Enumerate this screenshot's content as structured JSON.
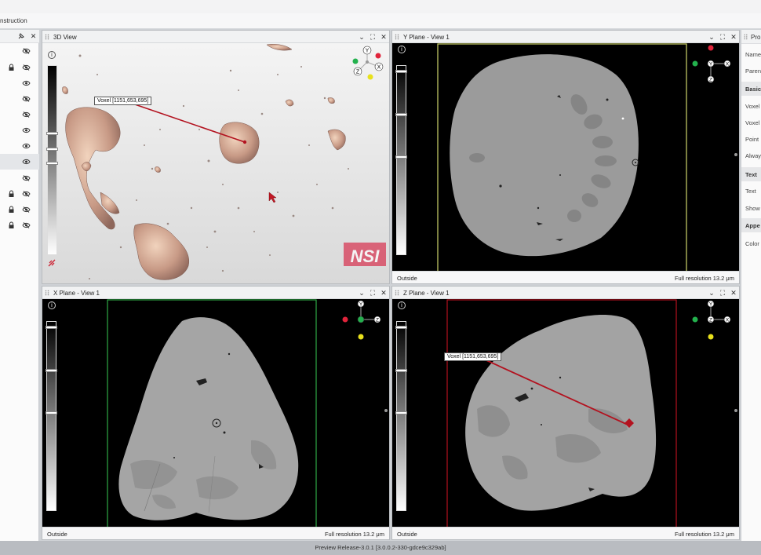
{
  "app": {
    "breadcrumb": "nstruction",
    "status": "Preview Release-3.0.1 [3.0.0.2-330-gdce9c329ab]"
  },
  "left_panel": {
    "rows": [
      {
        "locked": false,
        "visible": false
      },
      {
        "locked": true,
        "visible": false
      },
      {
        "locked": false,
        "visible": true
      },
      {
        "locked": false,
        "visible": false
      },
      {
        "locked": false,
        "visible": false
      },
      {
        "locked": false,
        "visible": true
      },
      {
        "locked": false,
        "visible": true
      },
      {
        "locked": false,
        "visible": true,
        "selected": true
      },
      {
        "locked": false,
        "visible": false
      },
      {
        "locked": true,
        "visible": false
      },
      {
        "locked": true,
        "visible": false
      },
      {
        "locked": true,
        "visible": false
      }
    ]
  },
  "right_panel": {
    "title": "Pro",
    "rows": [
      "Name",
      "Paren"
    ],
    "section_basic": "Basic",
    "basic_rows": [
      "Voxel",
      "Voxel",
      "Point",
      "Alway"
    ],
    "section_text": "Text",
    "text_rows": [
      "Text",
      "Show"
    ],
    "section_appearance": "Appe",
    "appearance_rows": [
      "Color"
    ]
  },
  "panes": {
    "view3d": {
      "title": "3D View",
      "voxel_label": "Voxel [1151,653,695]",
      "logo": "NSI"
    },
    "yplane": {
      "title": "Y Plane - View 1",
      "footer_left": "Outside",
      "footer_right": "Full resolution 13.2 μm"
    },
    "xplane": {
      "title": "X Plane - View 1",
      "footer_left": "Outside",
      "footer_right": "Full resolution 13.2 μm"
    },
    "zplane": {
      "title": "Z Plane - View 1",
      "voxel_label": "Voxel [1151,653,695]",
      "footer_left": "Outside",
      "footer_right": "Full resolution 13.2 μm"
    }
  },
  "axes": {
    "x": "X",
    "y": "Y",
    "z": "Z"
  },
  "colors": {
    "measure_line": "#b3121f",
    "y_frame": "#cfd46a",
    "x_frame": "#2eab45",
    "z_frame": "#b3121f",
    "axis_red": "#e0243b",
    "axis_green": "#23b14d",
    "axis_yellow": "#e8e11c"
  }
}
